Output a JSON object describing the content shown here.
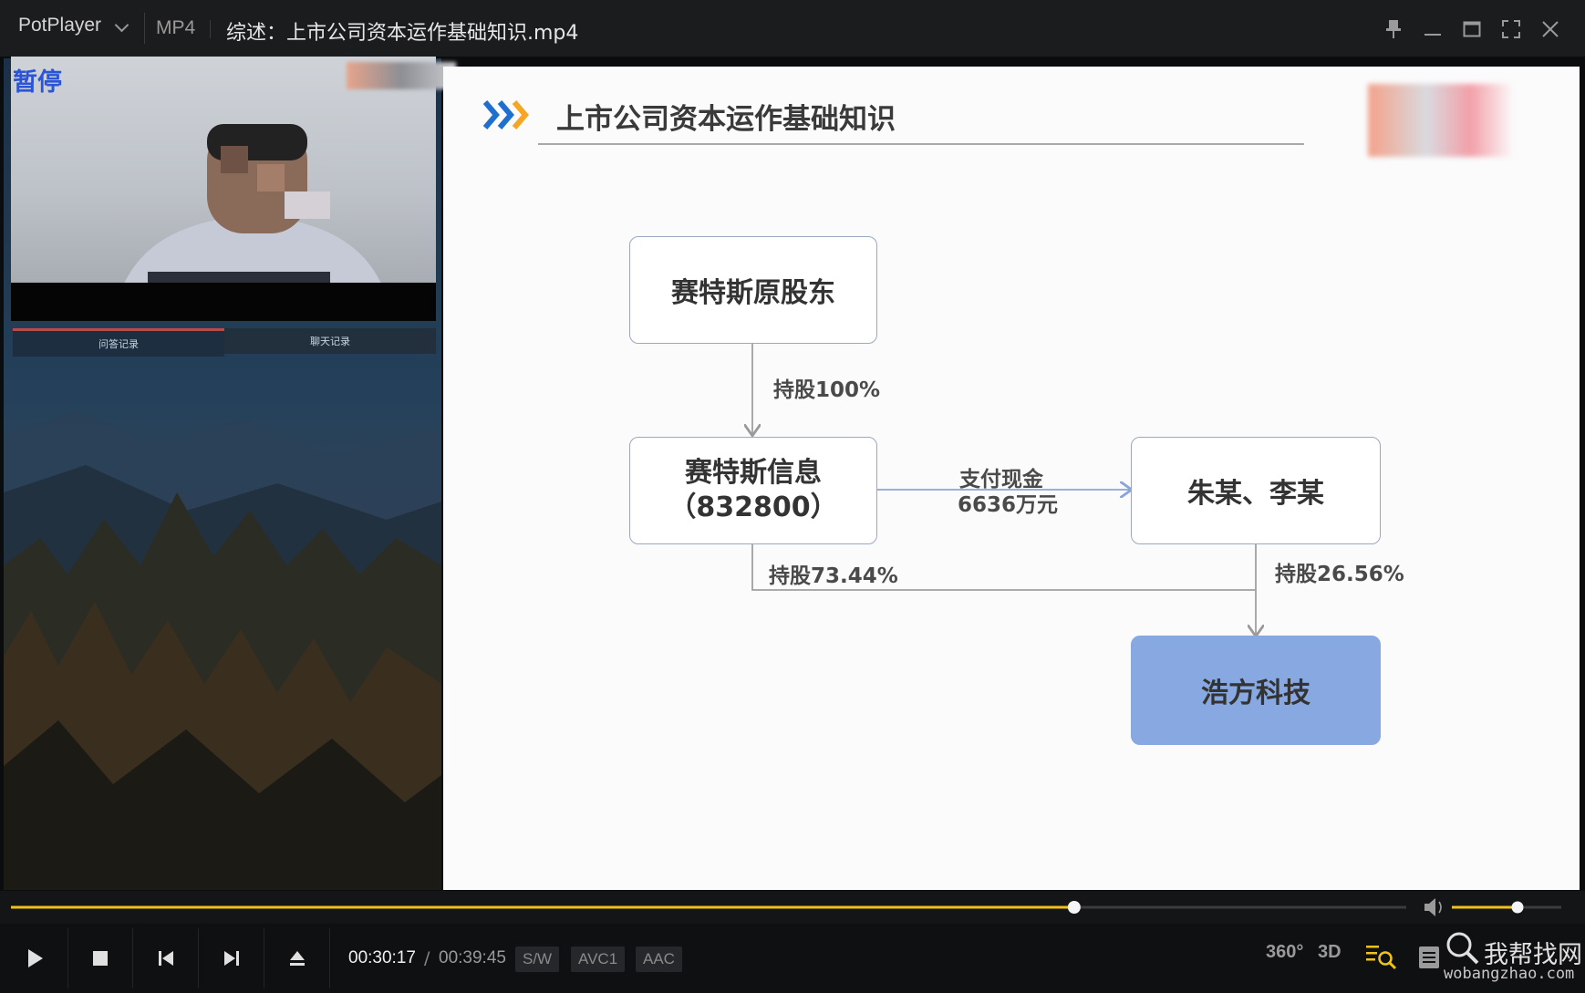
{
  "app": {
    "name": "PotPlayer",
    "format": "MP4",
    "file_title": "综述：上市公司资本运作基础知识.mp4"
  },
  "window_controls": [
    "pin-icon",
    "minimize-icon",
    "maximize-icon",
    "fullscreen-icon",
    "close-icon"
  ],
  "overlay": {
    "status": "暂停"
  },
  "side_panel": {
    "tabs": [
      {
        "label": "问答记录",
        "active": true
      },
      {
        "label": "聊天记录",
        "active": false
      }
    ]
  },
  "slide": {
    "heading": "上市公司资本运作基础知识",
    "nodes": {
      "shareholders": "赛特斯原股东",
      "company_line1": "赛特斯信息",
      "company_line2": "（832800）",
      "persons": "朱某、李某",
      "target": "浩方科技"
    },
    "edges": {
      "hold_100": "持股100%",
      "pay_line1": "支付现金",
      "pay_line2": "6636万元",
      "hold_7344": "持股73.44%",
      "hold_2656": "持股26.56%"
    }
  },
  "player": {
    "time_current": "00:30:17",
    "time_separator": "/",
    "time_total": "00:39:45",
    "badges": [
      "S/W",
      "AVC1",
      "AAC"
    ],
    "progress_fraction": 0.762,
    "volume_fraction": 0.6,
    "right_icons": [
      "360°",
      "3D"
    ]
  },
  "watermark": {
    "text": "我帮找网",
    "url": "wobangzhao.com"
  },
  "colors": {
    "accent_yellow": "#f2c21b",
    "target_fill": "#87a8e0",
    "chevron_blue": "#1f6fd1",
    "chevron_orange": "#f5a623"
  }
}
